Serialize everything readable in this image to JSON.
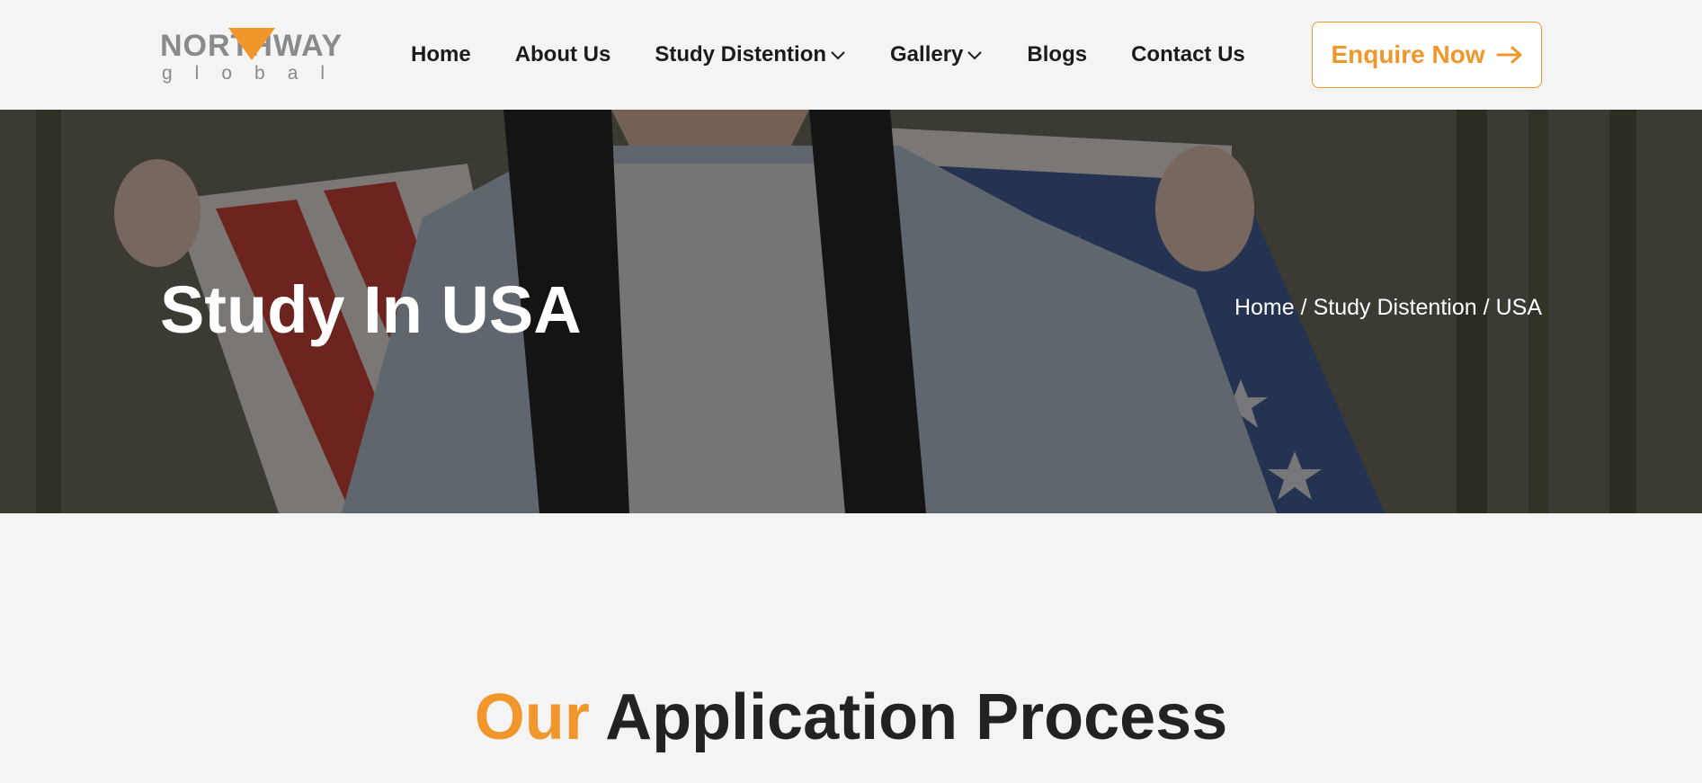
{
  "brand": {
    "name": "NORTHWAY",
    "tagline": "global",
    "accent_color": "#f0962a",
    "text_color": "#8a8a8a"
  },
  "nav": {
    "items": [
      {
        "label": "Home",
        "dropdown": false
      },
      {
        "label": "About Us",
        "dropdown": false
      },
      {
        "label": "Study Distention",
        "dropdown": true
      },
      {
        "label": "Gallery",
        "dropdown": true
      },
      {
        "label": "Blogs",
        "dropdown": false
      },
      {
        "label": "Contact Us",
        "dropdown": false
      }
    ],
    "cta_label": "Enquire Now",
    "cta_icon": "arrow-right-icon"
  },
  "hero": {
    "title": "Study In USA",
    "breadcrumb": [
      "Home",
      "Study Distention",
      "USA"
    ],
    "separator": "/",
    "image_subject": "person holding american flag"
  },
  "section": {
    "title_accent": "Our",
    "title_rest": "Application Process"
  },
  "colors": {
    "accent": "#f0962a",
    "heading": "#222222",
    "background": "#f4f4f4"
  }
}
